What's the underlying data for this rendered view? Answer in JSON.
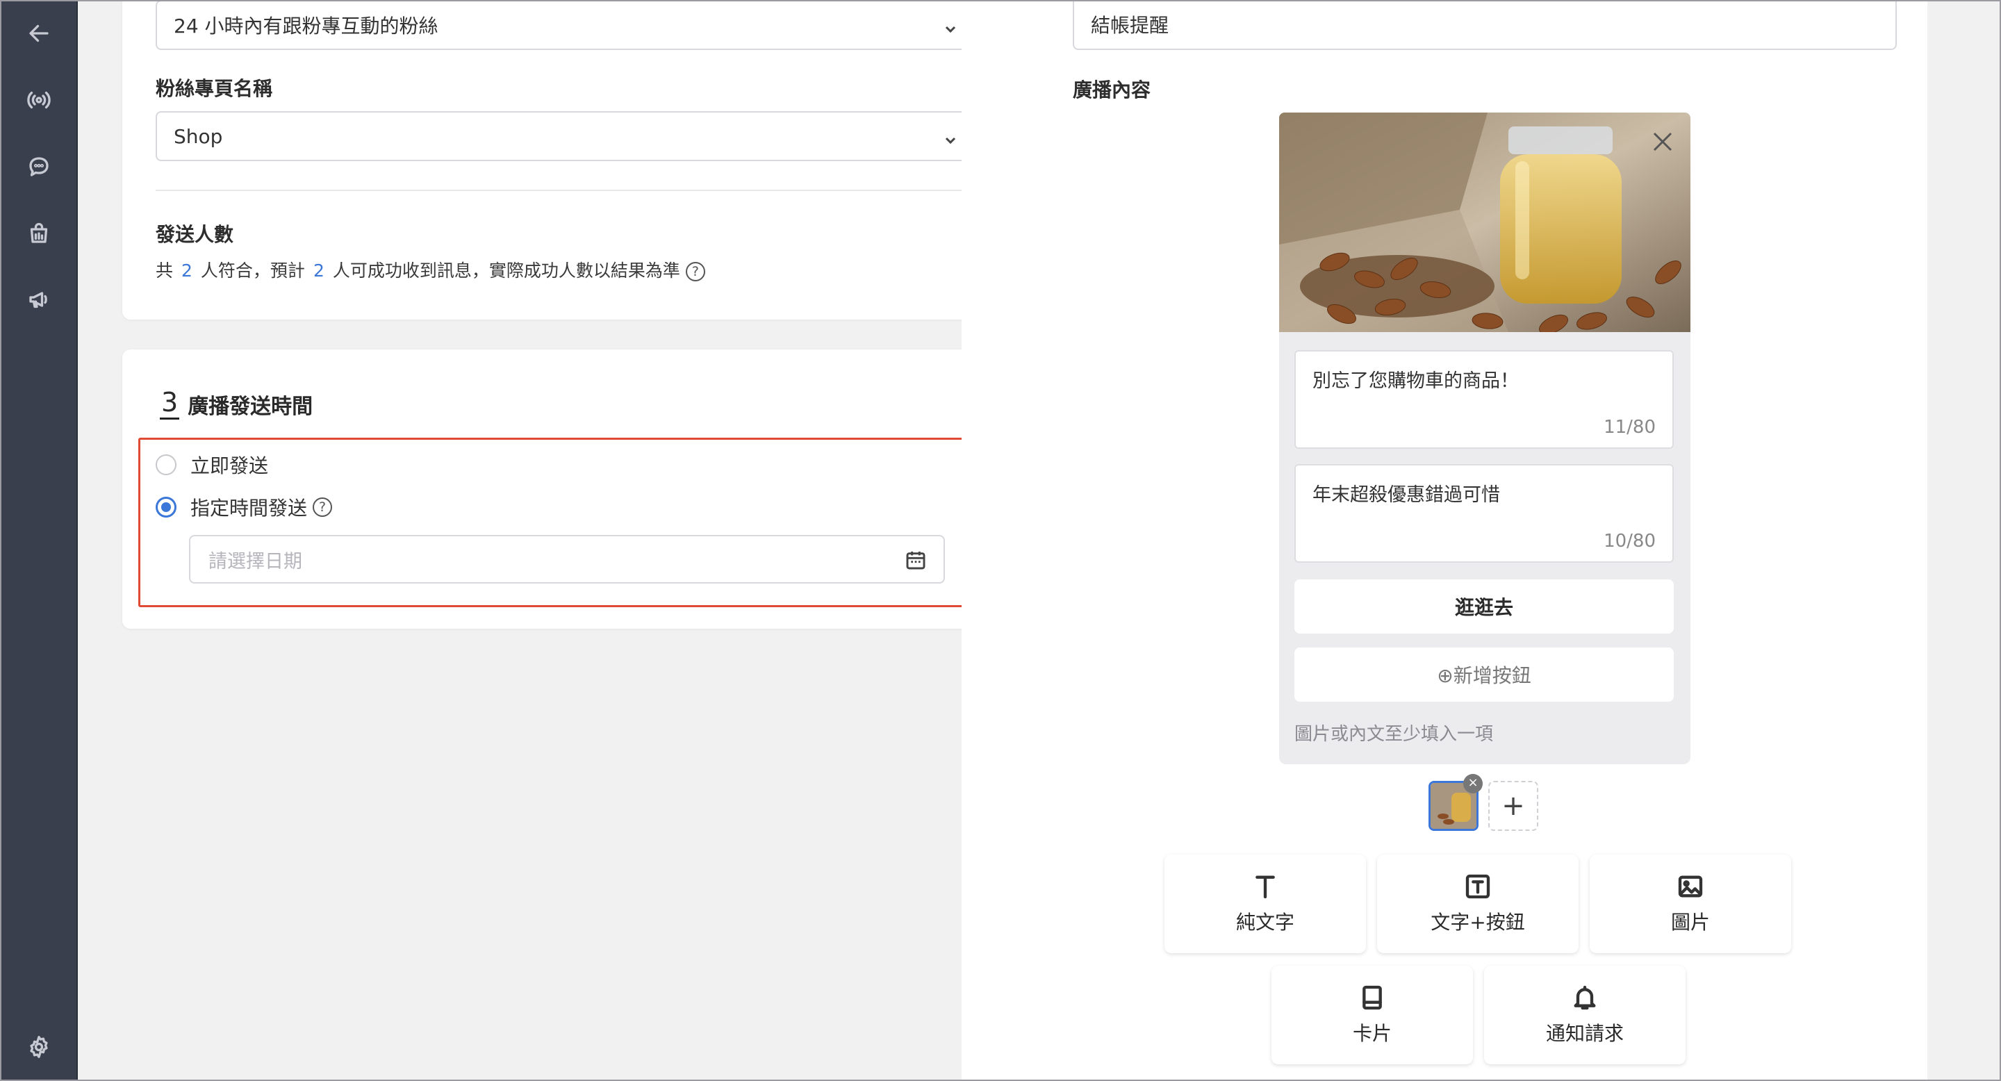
{
  "audience": {
    "target_value": "24 小時內有跟粉專互動的粉絲",
    "page_name_label": "粉絲專頁名稱",
    "page_name_value": "Shop",
    "send_count_label": "發送人數",
    "count_text_prefix": "共",
    "count_total": "2",
    "count_text_mid": "人符合，預計",
    "count_expected": "2",
    "count_text_suffix": "人可成功收到訊息，實際成功人數以結果為準",
    "help_icon_char": "?"
  },
  "schedule": {
    "step_number": "3",
    "step_title": "廣播發送時間",
    "option_immediate": "立即發送",
    "option_scheduled": "指定時間發送",
    "date_placeholder": "請選擇日期",
    "selected": "scheduled",
    "highlight_color": "#e04a35"
  },
  "broadcast": {
    "name_value": "結帳提醒",
    "content_label": "廣播內容",
    "title_text": "別忘了您購物車的商品！",
    "title_count": "11/80",
    "subtitle_text": "年末超殺優惠錯過可惜",
    "subtitle_count": "10/80",
    "button_label": "逛逛去",
    "add_button_label": "⊕新增按鈕",
    "hint": "圖片或內文至少填入一項",
    "add_thumb_char": "+",
    "thumb_close_char": "×"
  },
  "message_types": [
    {
      "label": "純文字",
      "icon": "text-icon"
    },
    {
      "label": "文字+按鈕",
      "icon": "text-button-icon"
    },
    {
      "label": "圖片",
      "icon": "image-icon"
    },
    {
      "label": "卡片",
      "icon": "card-icon"
    },
    {
      "label": "通知請求",
      "icon": "bell-icon"
    }
  ],
  "colors": {
    "sidebar": "#3a3f4e",
    "accent": "#3b77d8"
  }
}
